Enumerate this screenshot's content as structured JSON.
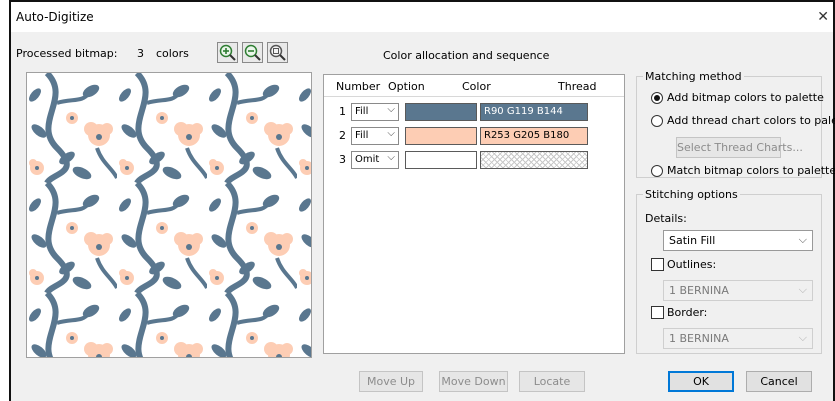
{
  "window": {
    "title": "Auto-Digitize",
    "close_glyph": "✕"
  },
  "bitmap": {
    "label": "Processed bitmap:",
    "count": "3",
    "unit": "colors",
    "zoom_buttons": [
      "zoom-in-icon",
      "zoom-out-icon",
      "zoom-fit-icon"
    ],
    "pattern_colors": {
      "background": "#ffffff",
      "vine": "#5a778f",
      "flower": "#fdcdb4"
    }
  },
  "allocation": {
    "heading": "Color allocation and sequence",
    "columns": [
      "Number",
      "Option",
      "Color",
      "Thread"
    ],
    "rows": [
      {
        "number": "1",
        "option": "Fill",
        "color": "#5a778f",
        "thread": "R90 G119 B144"
      },
      {
        "number": "2",
        "option": "Fill",
        "color": "#fdcdb4",
        "thread": "R253 G205 B180"
      },
      {
        "number": "3",
        "option": "Omit",
        "color": "#ffffff",
        "thread": ""
      }
    ]
  },
  "matching": {
    "legend": "Matching method",
    "options": [
      {
        "label": "Add bitmap colors to palette",
        "selected": true
      },
      {
        "label": "Add thread chart colors to palette",
        "selected": false
      },
      {
        "label": "Match bitmap colors to palette",
        "selected": false
      }
    ],
    "select_charts": "Select Thread Charts..."
  },
  "stitching": {
    "legend": "Stitching options",
    "details_label": "Details:",
    "details_value": "Satin Fill",
    "outlines_label": "Outlines:",
    "outlines_value": "1 BERNINA",
    "border_label": "Border:",
    "border_value": "1 BERNINA"
  },
  "footer": {
    "move_up": "Move Up",
    "move_down": "Move Down",
    "locate": "Locate",
    "ok": "OK",
    "cancel": "Cancel"
  }
}
